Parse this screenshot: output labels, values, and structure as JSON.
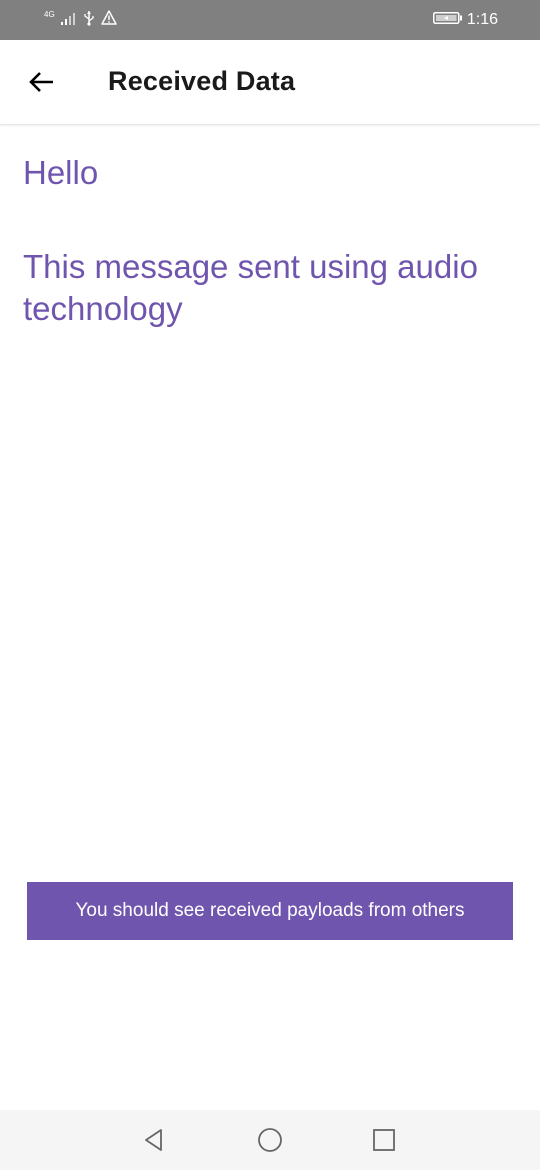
{
  "status_bar": {
    "network_label": "4G",
    "time": "1:16",
    "icons": [
      "signal-icon",
      "usb-icon",
      "warning-icon",
      "battery-icon"
    ],
    "background": "#808080"
  },
  "app_bar": {
    "back_icon": "arrow-left-icon",
    "title": "Received Data"
  },
  "messages": [
    "Hello",
    "This message sent using audio technology"
  ],
  "banner": {
    "text": "You should see received payloads from others",
    "color": "#6f55ae"
  },
  "nav_bar": {
    "icons": [
      "nav-back-icon",
      "nav-home-icon",
      "nav-recents-icon"
    ]
  },
  "colors": {
    "accent": "#6f55ae",
    "title_text": "#1a1a1a"
  }
}
